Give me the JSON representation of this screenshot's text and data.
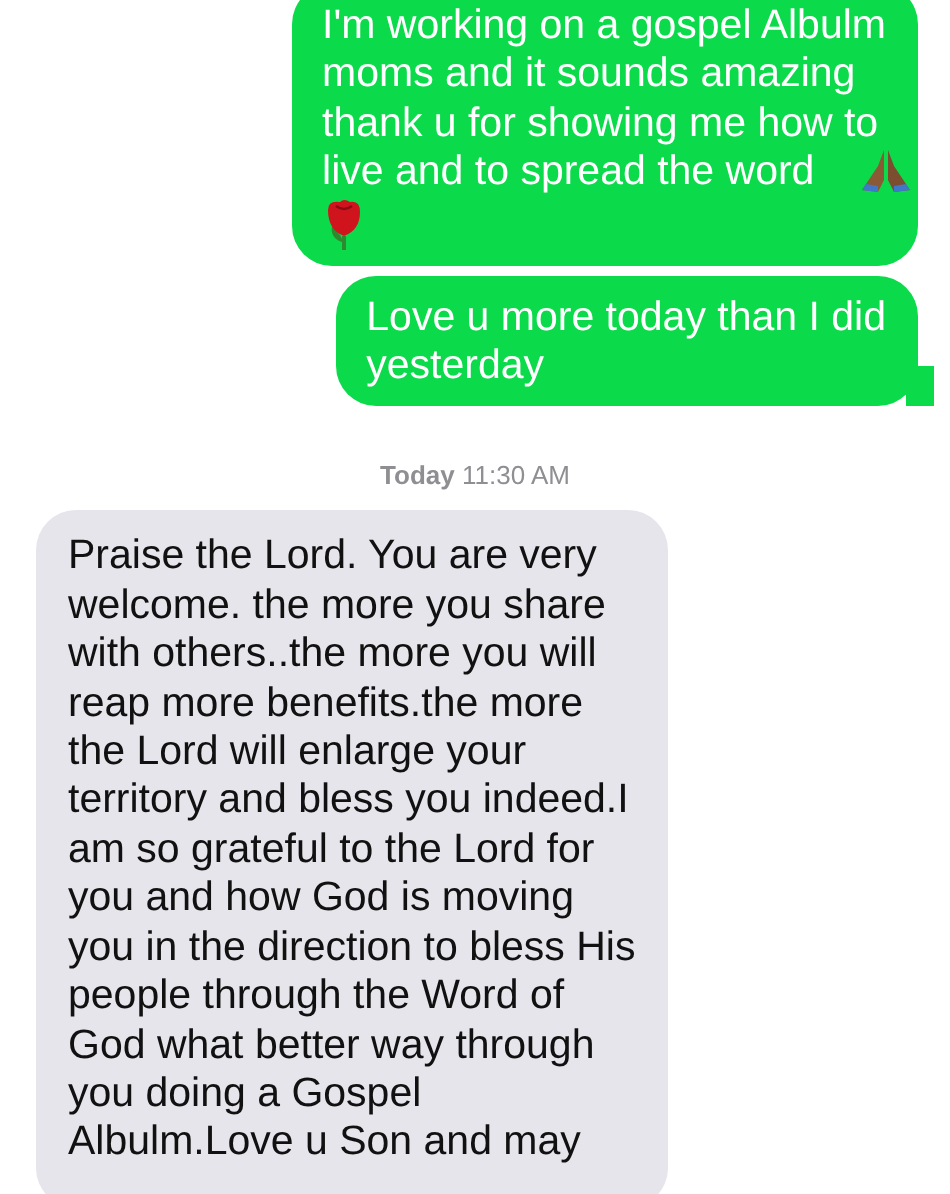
{
  "messages": [
    {
      "kind": "sent",
      "text": "I'm working on a gospel Albulm\nmoms and it sounds amazing\nthank u for showing me how to\nlive and to spread the word",
      "emoji_icons": true,
      "tail": false
    },
    {
      "kind": "sent",
      "text": "Love u more today than I did\nyesterday",
      "emoji_icons": false,
      "tail": true
    },
    {
      "kind": "timestamp",
      "day": "Today",
      "time": "11:30 AM"
    },
    {
      "kind": "received",
      "text": "Praise the Lord. You are very\nwelcome. the more you share\nwith others..the more you will\nreap more benefits.the more\nthe Lord will enlarge your\nterritory and bless you indeed.I\nam so grateful to the Lord for\nyou and how God is moving\nyou in the direction to bless His\npeople  through the Word of\nGod what better way through\nyou doing a  Gospel\nAlbulm.Love u Son and may",
      "emoji_icons": false,
      "tail": false
    }
  ]
}
